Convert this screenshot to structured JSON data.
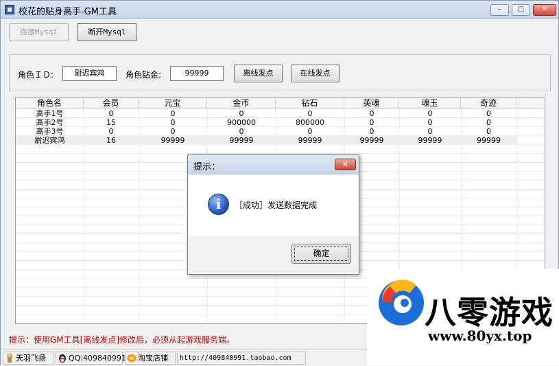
{
  "window": {
    "title": "校花的贴身高手-GM工具",
    "controls": {
      "minimize": "–",
      "maximize": "□",
      "close": "✕"
    }
  },
  "toolbar": {
    "connect_label": "连接Mysql",
    "disconnect_label": "断开Mysql"
  },
  "form": {
    "role_id_label": "角色ＩＤ:",
    "role_id_value": "尉迟宾鸿",
    "diamond_label": "角色钻金:",
    "diamond_value": "99999",
    "offline_send_label": "离线发点",
    "online_send_label": "在线发点"
  },
  "table": {
    "columns": [
      "角色名",
      "会员",
      "元宝",
      "金币",
      "钻石",
      "英魂",
      "魂玉",
      "奇迹"
    ],
    "rows": [
      [
        "高手1号",
        "0",
        "0",
        "0",
        "0",
        "0",
        "0",
        "0"
      ],
      [
        "高手2号",
        "15",
        "0",
        "900000",
        "800000",
        "0",
        "0",
        "0"
      ],
      [
        "高手3号",
        "0",
        "0",
        "0",
        "0",
        "0",
        "0",
        "0"
      ],
      [
        "尉迟宾鸿",
        "16",
        "99999",
        "99999",
        "99999",
        "99999",
        "99999",
        "99999"
      ]
    ]
  },
  "hint": "提示：使用GM工具[离线发点]修改后，必须从起游戏服务端。",
  "statusbar": {
    "author": "天羽飞扬",
    "qq": "QQ:409840991",
    "shop": "淘宝店铺",
    "url": "http://409840991.taobao.com"
  },
  "dialog": {
    "title": "提示：",
    "close": "✕",
    "icon": "i",
    "message": "［成功］发送数据完成",
    "ok_label": "确定"
  },
  "watermark": {
    "brand": "八零游戏",
    "url": "www.80yx.top"
  }
}
